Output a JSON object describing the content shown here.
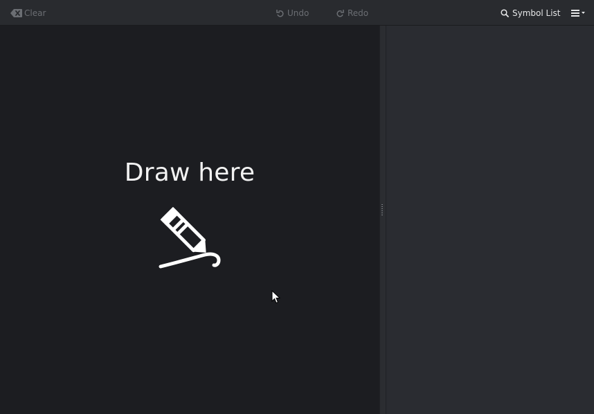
{
  "toolbar": {
    "clear_label": "Clear",
    "undo_label": "Undo",
    "redo_label": "Redo",
    "symbol_list_label": "Symbol List",
    "icons": {
      "clear": "backspace-icon",
      "undo": "undo-icon",
      "redo": "redo-icon",
      "symbol_list": "search-icon",
      "menu": "hamburger-menu-icon"
    }
  },
  "canvas": {
    "prompt": "Draw here",
    "icon": "pencil-draw-icon"
  },
  "colors": {
    "toolbar_bg": "#292b2f",
    "canvas_bg": "#1c1d21",
    "panel_bg": "#2a2c31",
    "text_enabled": "#e6e7e8",
    "text_disabled": "#6b6e73"
  }
}
